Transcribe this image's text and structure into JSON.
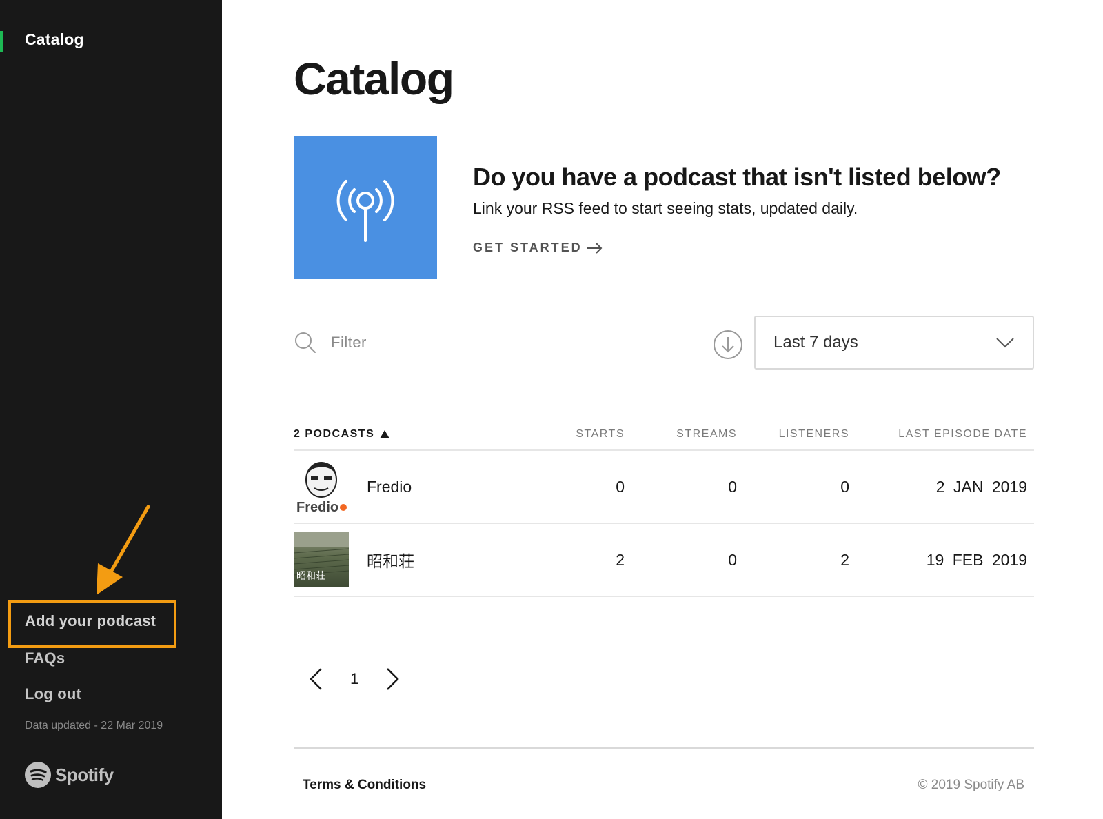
{
  "sidebar": {
    "title": "Catalog",
    "links": {
      "add_podcast": "Add your podcast",
      "faqs": "FAQs",
      "logout": "Log out"
    },
    "data_updated": "Data updated - 22 Mar 2019",
    "logo_text": "Spotify",
    "accent_color": "#1db954"
  },
  "main": {
    "title": "Catalog",
    "promo": {
      "heading": "Do you have a podcast that isn't listed below?",
      "subtext": "Link your RSS feed to start seeing stats, updated daily.",
      "cta": "GET STARTED",
      "art_color": "#4a90e2",
      "art_icon": "podcast-broadcast-icon"
    },
    "filter": {
      "placeholder": "Filter"
    },
    "date_range": {
      "selected": "Last 7 days"
    },
    "table": {
      "columns": {
        "name": "2 PODCASTS",
        "starts": "STARTS",
        "streams": "STREAMS",
        "listeners": "LISTENERS",
        "last_episode": "LAST EPISODE DATE"
      },
      "rows": [
        {
          "name": "Fredio",
          "thumb_text": "Fredio",
          "starts": "0",
          "streams": "0",
          "listeners": "0",
          "last_episode": "2 JAN 2019"
        },
        {
          "name": "昭和荘",
          "thumb_text": "昭和荘",
          "starts": "2",
          "streams": "0",
          "listeners": "2",
          "last_episode": "19 FEB 2019"
        }
      ]
    },
    "pagination": {
      "current": "1"
    },
    "footer": {
      "terms": "Terms & Conditions",
      "copyright": "© 2019 Spotify AB"
    }
  },
  "annotation": {
    "highlight_color": "#f39c12"
  }
}
